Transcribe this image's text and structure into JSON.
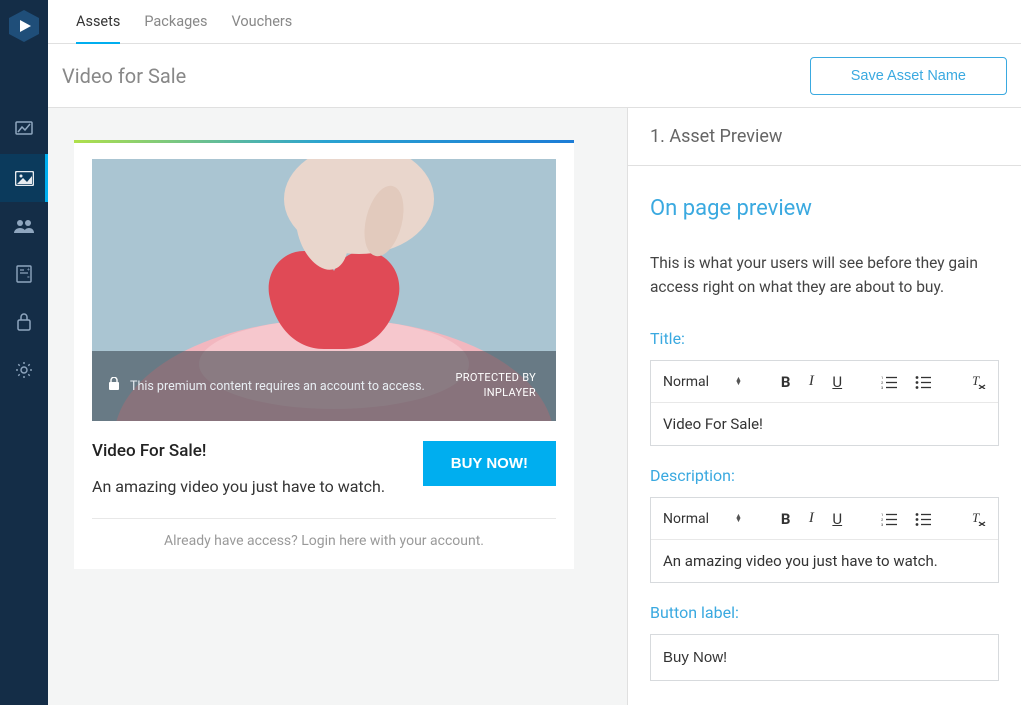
{
  "tabs": {
    "assets": "Assets",
    "packages": "Packages",
    "vouchers": "Vouchers"
  },
  "pageTitle": "Video for Sale",
  "saveBtn": "Save Asset Name",
  "preview": {
    "overlayLock": "This premium content requires an account to access.",
    "protectedLine1": "PROTECTED BY",
    "protectedLine2": "INPLAYER",
    "title": "Video For Sale!",
    "desc": "An amazing video you just have to watch.",
    "buy": "BUY NOW!",
    "login": "Already have access? Login here with your account."
  },
  "step": "1. Asset Preview",
  "form": {
    "heading": "On page preview",
    "desc": "This is what your users will see before they gain access right on what they are about to buy.",
    "titleLabel": "Title:",
    "descLabel": "Description:",
    "btnLabel": "Button label:",
    "selectText": "Normal",
    "titleValue": "Video For Sale!",
    "descValue": "An amazing video you just have to watch.",
    "btnValue": "Buy Now!"
  }
}
